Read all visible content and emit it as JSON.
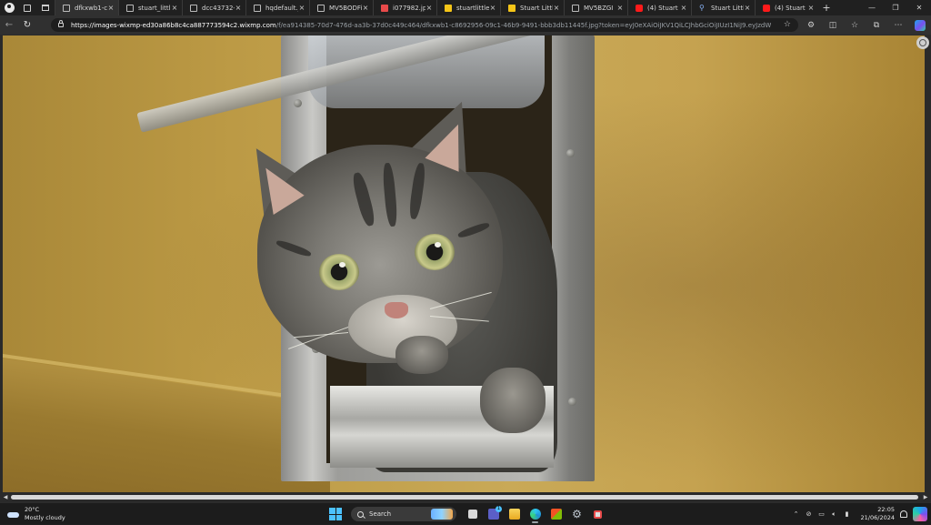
{
  "browser": {
    "tabs": [
      {
        "label": "dfkxwb1-c",
        "favicon": "doc-icon",
        "active": true
      },
      {
        "label": "stuart_little",
        "favicon": "doc-icon"
      },
      {
        "label": "dcc43732-f",
        "favicon": "doc-icon"
      },
      {
        "label": "hqdefault.jp",
        "favicon": "doc-icon"
      },
      {
        "label": "MV5BODFi",
        "favicon": "doc-icon"
      },
      {
        "label": "i077982.jpg",
        "favicon": "image-icon"
      },
      {
        "label": "stuartlittle",
        "favicon": "yellow-site-icon"
      },
      {
        "label": "Stuart Little",
        "favicon": "imdb-icon"
      },
      {
        "label": "MV5BZGI",
        "favicon": "doc-icon"
      },
      {
        "label": "(4) Stuart Li",
        "favicon": "youtube-icon"
      },
      {
        "label": "Stuart Little",
        "favicon": "search-icon"
      },
      {
        "label": "(4) Stuart Li",
        "favicon": "youtube-icon"
      }
    ],
    "new_tab_symbol": "+",
    "url_host": "https://images-wixmp-ed30a86b8c4ca887773594c2.wixmp.com",
    "url_rest": "/f/ea914385-70d7-476d-aa3b-37d0c449c464/dfkxwb1-c8692956-09c1-46b9-9491-bbb3db11445f.jpg?token=eyJ0eXAiOiJKV1QiLCJhbGciOiJIUzI1NiJ9.eyJzdWIiOiJ1cm46YX"
  },
  "taskbar": {
    "weather_temp": "20°C",
    "weather_desc": "Mostly cloudy",
    "search_placeholder": "Search",
    "teams_badge": "1",
    "time": "22:05",
    "date": "21/06/2024"
  },
  "colors": {
    "accent": "#4cc2ff",
    "tab_bg": "#202020",
    "toolbar_bg": "#303030"
  }
}
